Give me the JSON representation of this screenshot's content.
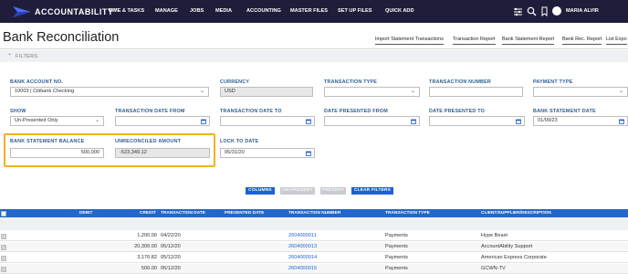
{
  "app": {
    "logo_text": "ACCOUNTABILITY",
    "logo_tm": "™",
    "nav": [
      {
        "label": "TIME & TASKS",
        "caret": false
      },
      {
        "label": "MANAGE",
        "caret": false
      },
      {
        "label": "JOBS",
        "caret": false
      },
      {
        "label": "MEDIA",
        "caret": false
      },
      {
        "label": "ACCOUNTING",
        "caret": false
      },
      {
        "label": "MASTER FILES",
        "caret": false
      },
      {
        "label": "SET UP FILES",
        "caret": false
      },
      {
        "label": "QUICK ADD",
        "caret": false
      }
    ],
    "user_name": "MARIA ALVIR",
    "colors": {
      "nav_bg": "#1f1d3a",
      "accent": "#1e5fd8",
      "label": "#2f5e8f",
      "highlight": "#f1b221"
    }
  },
  "page": {
    "title": "Bank Reconciliation",
    "report_links": [
      "Import Statement Transactions",
      "Transaction Report",
      "Bank Statement Report",
      "Bank Rec. Report",
      "List Expo"
    ],
    "filters_label": "FILTERS"
  },
  "form": {
    "bank_account": {
      "label": "BANK ACCOUNT NO.",
      "value": "10003 | Citibank Checking"
    },
    "currency": {
      "label": "CURRENCY",
      "value": "USD"
    },
    "transaction_type": {
      "label": "TRANSACTION TYPE",
      "value": ""
    },
    "transaction_number": {
      "label": "TRANSACTION NUMBER",
      "value": ""
    },
    "payment_type": {
      "label": "PAYMENT TYPE",
      "value": ""
    },
    "show": {
      "label": "SHOW",
      "value": "Un-Presented Only"
    },
    "date_from": {
      "label": "TRANSACTION DATE FROM",
      "value": ""
    },
    "date_to": {
      "label": "TRANSACTION DATE TO",
      "value": ""
    },
    "presented_from": {
      "label": "DATE PRESENTED FROM",
      "value": ""
    },
    "presented_to": {
      "label": "DATE PRESENTED TO",
      "value": ""
    },
    "statement_date": {
      "label": "BANK STATEMENT DATE",
      "value": "01/09/23"
    },
    "statement_balance": {
      "label": "BANK STATEMENT BALANCE",
      "value": "500,000"
    },
    "unreconciled": {
      "label": "UNRECONCILED AMOUNT",
      "value": "-523,349.12"
    },
    "lock_to": {
      "label": "LOCK TO DATE",
      "value": "05/31/20"
    }
  },
  "actions": {
    "columns": "COLUMNS",
    "un_present": "UN-PRESENT",
    "present": "PRESENT",
    "clear_filters": "CLEAR FILTERS"
  },
  "grid": {
    "columns": {
      "debit": "DEBIT",
      "credit": "CREDIT",
      "transaction_date": "TRANSACTION DATE",
      "presented_date": "PRESENTED DATE",
      "transaction_number": "TRANSACTION NUMBER",
      "transaction_type": "TRANSACTION TYPE",
      "client": "CLIENT/SUPPLIER/DESCRIPTION"
    },
    "rows": [
      {
        "credit": "1,200.00",
        "date": "04/22/20",
        "number": "2604000011",
        "type": "Payments",
        "client": "Hype Beast"
      },
      {
        "credit": "20,300.00",
        "date": "05/12/20",
        "number": "2604000013",
        "type": "Payments",
        "client": "AccountAbility Support"
      },
      {
        "credit": "3,176.82",
        "date": "05/12/20",
        "number": "2604000014",
        "type": "Payments",
        "client": "American Express Corporate"
      },
      {
        "credit": "500.00",
        "date": "05/12/20",
        "number": "2604000015",
        "type": "Payments",
        "client": "GCWN-TV"
      }
    ]
  }
}
